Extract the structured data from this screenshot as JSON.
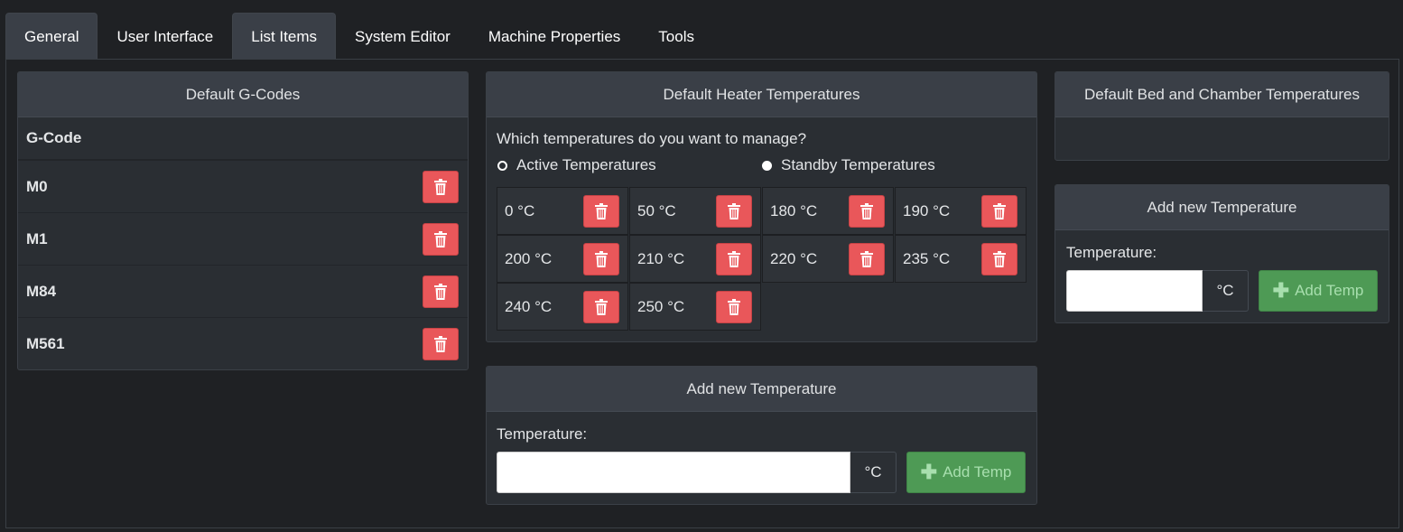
{
  "tabs": [
    {
      "label": "General"
    },
    {
      "label": "User Interface"
    },
    {
      "label": "List Items"
    },
    {
      "label": "System Editor"
    },
    {
      "label": "Machine Properties"
    },
    {
      "label": "Tools"
    }
  ],
  "gcodes": {
    "title": "Default G-Codes",
    "column_header": "G-Code",
    "rows": [
      {
        "code": "M0"
      },
      {
        "code": "M1"
      },
      {
        "code": "M84"
      },
      {
        "code": "M561"
      }
    ]
  },
  "heater": {
    "title": "Default Heater Temperatures",
    "question": "Which temperatures do you want to manage?",
    "options": [
      {
        "label": "Active Temperatures",
        "selected": false
      },
      {
        "label": "Standby Temperatures",
        "selected": true
      }
    ],
    "temps": [
      "0 °C",
      "50 °C",
      "180 °C",
      "190 °C",
      "200 °C",
      "210 °C",
      "220 °C",
      "235 °C",
      "240 °C",
      "250 °C"
    ]
  },
  "add_heater": {
    "title": "Add new Temperature",
    "label": "Temperature:",
    "value": "",
    "unit": "°C",
    "button_label": "Add Temp"
  },
  "bed": {
    "title": "Default Bed and Chamber Temperatures"
  },
  "add_bed": {
    "title": "Add new Temperature",
    "label": "Temperature:",
    "value": "",
    "unit": "°C",
    "button_label": "Add Temp"
  },
  "icons": {
    "delete": "trash-icon",
    "add": "plus-icon"
  },
  "colors": {
    "background": "#1f2124",
    "panel": "#2a2e33",
    "panel_header": "#3a3f47",
    "danger": "#e9575a",
    "success": "#4e9a55"
  }
}
